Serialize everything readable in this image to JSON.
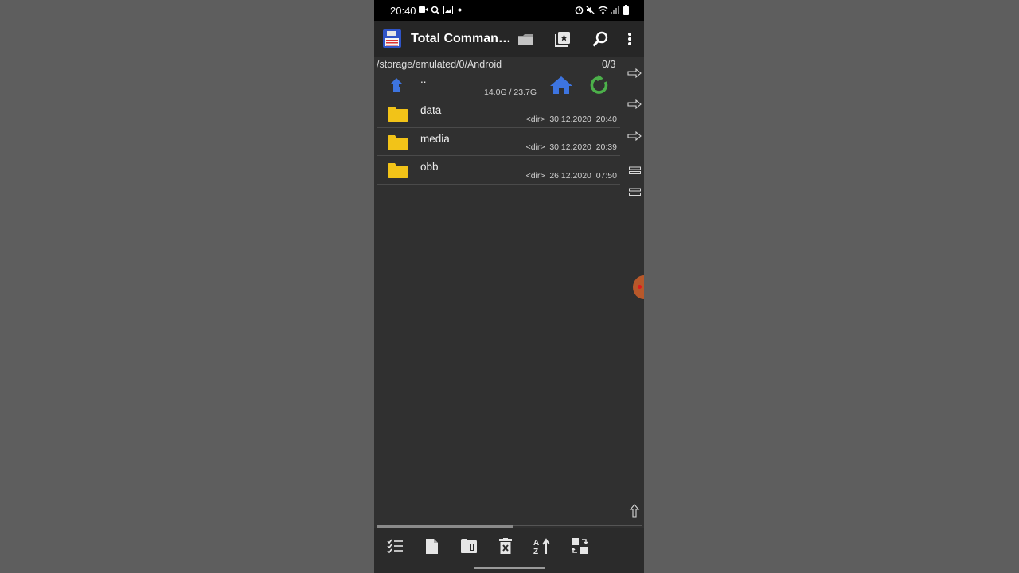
{
  "status_bar": {
    "time": "20:40"
  },
  "toolbar": {
    "title": "Total Comman…"
  },
  "panel": {
    "path": "/storage/emulated/0/Android",
    "selection_count": "0/3",
    "parent": {
      "name": "..",
      "space": "14.0G / 23.7G"
    },
    "rows": [
      {
        "name": "data",
        "meta": "<dir>  30.12.2020  20:40"
      },
      {
        "name": "media",
        "meta": "<dir>  30.12.2020  20:39"
      },
      {
        "name": "obb",
        "meta": "<dir>  26.12.2020  07:50"
      }
    ]
  },
  "colors": {
    "folder": "#f2c318",
    "home": "#3d74e0",
    "refresh": "#4cb04a",
    "up_arrow": "#3d74e0"
  },
  "icons": {
    "bottom": [
      "select-icon",
      "new-file-icon",
      "new-folder-icon",
      "delete-icon",
      "sort-icon",
      "copy-move-icon"
    ],
    "side": [
      "arrow-right-icon",
      "arrow-right-icon",
      "arrow-right-icon",
      "equals-icon",
      "equals-icon",
      "arrow-up-icon"
    ]
  }
}
